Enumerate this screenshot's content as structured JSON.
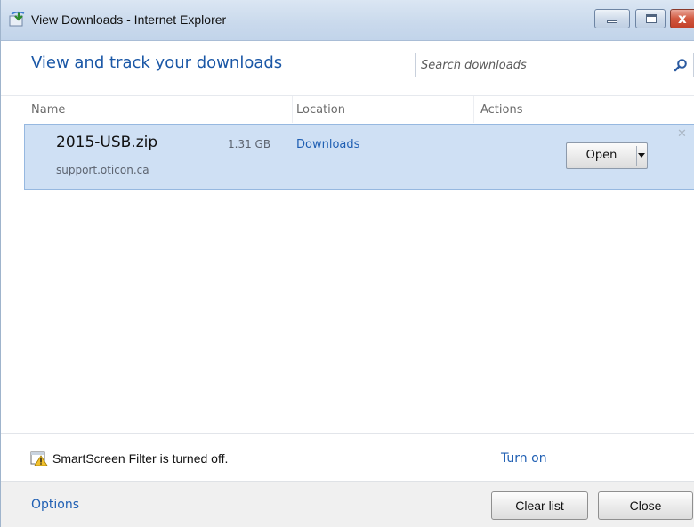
{
  "window": {
    "title": "View Downloads - Internet Explorer",
    "controls": {
      "minimize": "minimize",
      "maximize": "maximize",
      "close": "x"
    }
  },
  "header": {
    "title": "View and track your downloads",
    "search_placeholder": "Search downloads"
  },
  "columns": {
    "name": "Name",
    "location": "Location",
    "actions": "Actions"
  },
  "downloads": [
    {
      "file_name": "2015-USB.zip",
      "size": "1.31 GB",
      "source": "support.oticon.ca",
      "location": "Downloads",
      "action": "Open",
      "selected": true
    }
  ],
  "smartscreen": {
    "message": "SmartScreen Filter is turned off.",
    "link": "Turn on"
  },
  "footer": {
    "options_link": "Options",
    "clear_button": "Clear list",
    "close_button": "Close"
  },
  "colors": {
    "accent_link": "#1f5fb3",
    "heading": "#1a57a6",
    "row_selected_bg": "#cfe0f4",
    "row_selected_border": "#96b8e0"
  }
}
